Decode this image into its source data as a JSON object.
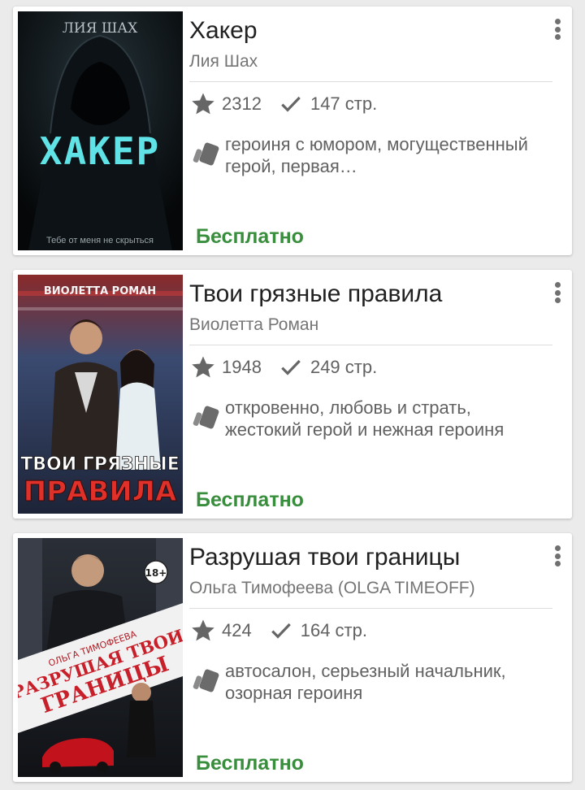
{
  "books": [
    {
      "title": "Хакер",
      "author": "Лия Шах",
      "rating_count": "2312",
      "pages": "147 стр.",
      "tags": "героиня с юмором, могущественный герой, первая…",
      "price": "Бесплатно",
      "cover": {
        "author_text": "ЛИЯ ШАХ",
        "title_text": "ХАКЕР",
        "tagline": "Тебе от меня не скрыться",
        "colors": {
          "bg": "#070a0d",
          "title": "#5fe3e6"
        }
      }
    },
    {
      "title": "Твои грязные правила",
      "author": "Виолетта Роман",
      "rating_count": "1948",
      "pages": "249 стр.",
      "tags": "откровенно, любовь и страть, жестокий герой и нежная героиня",
      "price": "Бесплатно",
      "cover": {
        "author_text": "ВИОЛЕТТА РОМАН",
        "title_line1": "ТВОИ ГРЯЗНЫЕ",
        "title_line2": "ПРАВИЛА",
        "colors": {
          "bg": "#2a3a58",
          "accent": "#e0302a"
        }
      }
    },
    {
      "title": "Разрушая твои границы",
      "author": "Ольга Тимофеева (OLGA TIMEOFF)",
      "rating_count": "424",
      "pages": "164 стр.",
      "tags": "автосалон, серьезный начальник, озорная героиня",
      "price": "Бесплатно",
      "cover": {
        "age_badge": "18+",
        "author_text": "ОЛЬГА ТИМОФЕЕВА",
        "title_line1": "РАЗРУШАЯ ТВОИ",
        "title_line2": "ГРАНИЦЫ",
        "colors": {
          "bg": "#1a1d24",
          "accent": "#c8202a"
        }
      }
    }
  ],
  "icons": {
    "rating": "star-icon",
    "pages": "check-icon",
    "tags": "tag-icon",
    "menu": "more-vert-icon"
  },
  "colors": {
    "price": "#388e3c",
    "secondary_text": "#616161",
    "icon": "#666666"
  }
}
